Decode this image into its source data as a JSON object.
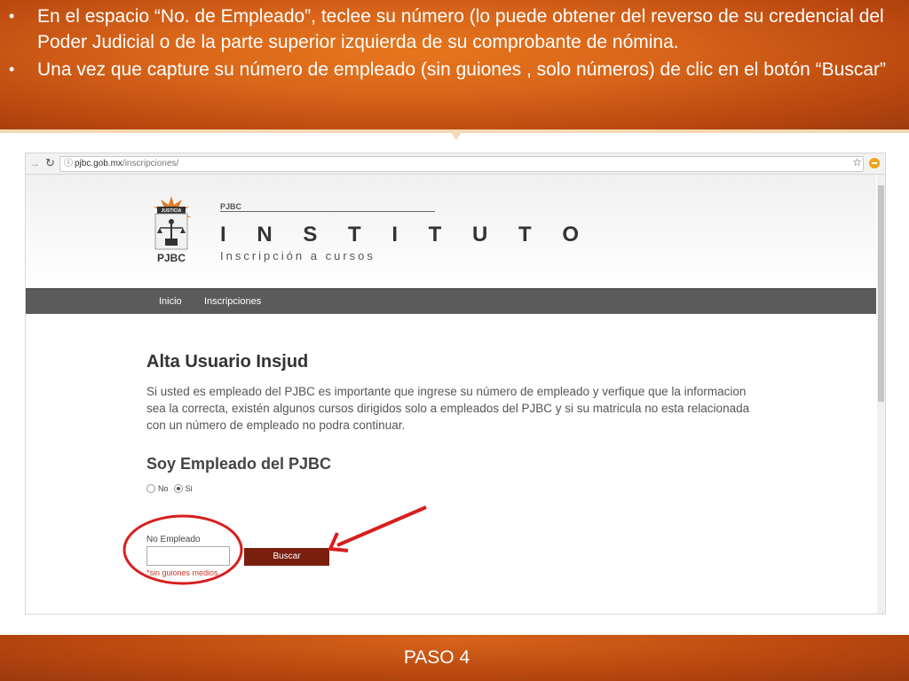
{
  "slide": {
    "bullets": [
      "En el espacio “No. de Empleado”, teclee su número (lo puede obtener del reverso de su credencial del Poder Judicial o de la parte superior izquierda de su comprobante de nómina.",
      "Una vez que capture su número de empleado (sin guiones , solo números) de clic en el botón “Buscar”"
    ],
    "footer": "PASO 4",
    "colors": {
      "band": "#d9661a",
      "accent_line": "#f3d9b4",
      "annotation": "#d81e1e"
    }
  },
  "browser": {
    "url_host": "pjbc.gob.mx",
    "url_path": "/inscripciones/"
  },
  "site": {
    "logo_text": "PJBC",
    "logo_banner": "JUSTICIA",
    "small_label": "PJBC",
    "title": "I N S T I T U T O",
    "subtitle": "Inscripción a cursos",
    "menu": [
      "Inicio",
      "Inscripciones"
    ],
    "colors": {
      "menu_bg": "#5b5b5b",
      "button": "#7a1e0d",
      "hint": "#c0392b"
    }
  },
  "form": {
    "heading": "Alta Usuario Insjud",
    "description": "Si usted es empleado del PJBC es importante que ingrese su número de empleado y verfique que la informacion sea la correcta, existén algunos cursos dirigidos solo a empleados del PJBC y si su matricula no esta relacionada con un número de empleado no podra continuar.",
    "subheading": "Soy Empleado del PJBC",
    "radio_no": "No",
    "radio_si": "Si",
    "selected": "Si",
    "employee_label": "No Empleado",
    "employee_value": "",
    "button_label": "Buscar",
    "hint": "*sin guiones medios"
  }
}
